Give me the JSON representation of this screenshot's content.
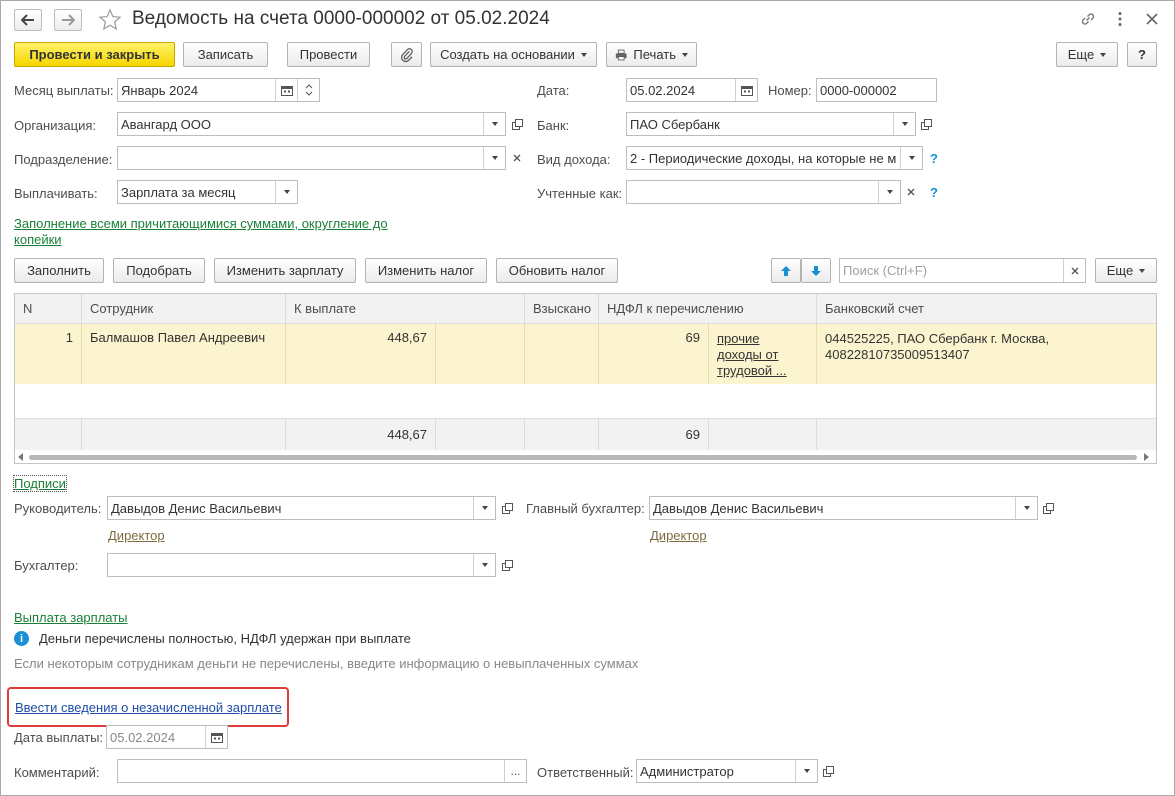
{
  "window": {
    "title": "Ведомость на счета 0000-000002 от 05.02.2024"
  },
  "toolbar": {
    "post_close": "Провести и закрыть",
    "save": "Записать",
    "post": "Провести",
    "create_based": "Создать на основании",
    "print": "Печать",
    "more": "Еще",
    "help": "?"
  },
  "form": {
    "month_label": "Месяц выплаты:",
    "month_value": "Январь 2024",
    "date_label": "Дата:",
    "date_value": "05.02.2024",
    "number_label": "Номер:",
    "number_value": "0000-000002",
    "org_label": "Организация:",
    "org_value": "Авангард ООО",
    "bank_label": "Банк:",
    "bank_value": "ПАО Сбербанк",
    "dept_label": "Подразделение:",
    "dept_value": "",
    "income_label": "Вид дохода:",
    "income_value": "2 - Периодические доходы, на которые не м",
    "pay_label": "Выплачивать:",
    "pay_value": "Зарплата за месяц",
    "counted_label": "Учтенные как:",
    "counted_value": "",
    "fill_link_line1": "Заполнение всеми причитающимися суммами, округление до",
    "fill_link_line2": "копейки"
  },
  "table_toolbar": {
    "fill": "Заполнить",
    "select": "Подобрать",
    "change_salary": "Изменить зарплату",
    "change_tax": "Изменить налог",
    "update_tax": "Обновить налог",
    "search_placeholder": "Поиск (Ctrl+F)",
    "more": "Еще"
  },
  "table": {
    "columns": [
      "N",
      "Сотрудник",
      "К выплате",
      "Взыскано",
      "НДФЛ к перечислению",
      "Банковский счет"
    ],
    "rows": [
      {
        "n": "1",
        "employee": "Балмашов Павел Андреевич",
        "to_pay": "448,67",
        "collected": "",
        "ndfl": "69",
        "income_type_l1": "прочие",
        "income_type_l2": "доходы от",
        "income_type_l3": "трудовой ...",
        "account_l1": "044525225, ПАО Сбербанк г. Москва,",
        "account_l2": "40822810735009513407"
      }
    ],
    "totals": {
      "to_pay": "448,67",
      "ndfl": "69"
    }
  },
  "signatures": {
    "section_link": "Подписи",
    "head_label": "Руководитель:",
    "head_value": "Давыдов Денис Васильевич",
    "head_position": "Директор",
    "chief_acc_label": "Главный бухгалтер:",
    "chief_acc_value": "Давыдов Денис Васильевич",
    "chief_acc_position": "Директор",
    "accountant_label": "Бухгалтер:",
    "accountant_value": ""
  },
  "payment": {
    "section_link": "Выплата зарплаты",
    "info_text": "Деньги перечислены  полностью, НДФЛ удержан при выплате",
    "hint_text": "Если некоторым сотрудникам деньги не перечислены, введите информацию о невыплаченных суммах",
    "unpaid_link": "Ввести сведения о незачисленной зарплате",
    "pay_date_label": "Дата выплаты:",
    "pay_date_value": "05.02.2024",
    "comment_label": "Комментарий:",
    "comment_value": "",
    "responsible_label": "Ответственный:",
    "responsible_value": "Администратор"
  }
}
